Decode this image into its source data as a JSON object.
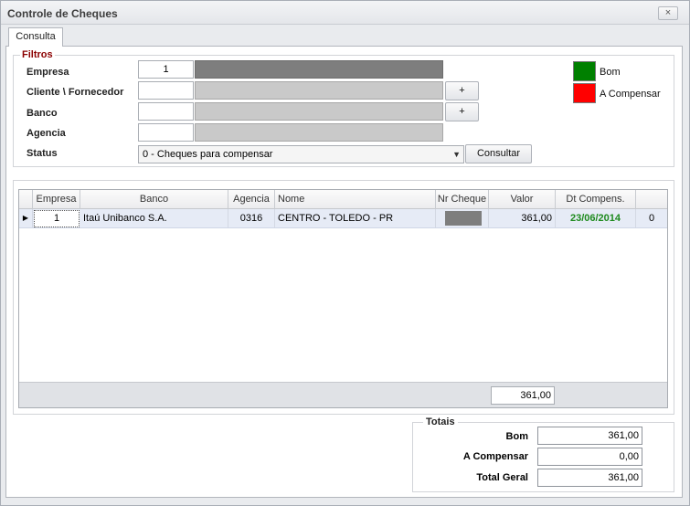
{
  "window": {
    "title": "Controle de Cheques",
    "close_icon": "×"
  },
  "tabs": [
    {
      "label": "Consulta"
    }
  ],
  "filtros": {
    "legend": "Filtros",
    "empresa": {
      "label": "Empresa",
      "value": "1"
    },
    "cliente": {
      "label": "Cliente \\ Fornecedor",
      "value": ""
    },
    "banco": {
      "label": "Banco",
      "value": ""
    },
    "agencia": {
      "label": "Agencia",
      "value": ""
    },
    "status": {
      "label": "Status",
      "value": "0 - Cheques para compensar"
    },
    "add_label": "+",
    "consultar_label": "Consultar"
  },
  "legend": [
    {
      "label": "Bom",
      "color": "#008000"
    },
    {
      "label": "A Compensar",
      "color": "#ff0000"
    }
  ],
  "grid": {
    "columns": [
      "Empresa",
      "Banco",
      "Agencia",
      "Nome",
      "Nr Cheque",
      "Valor",
      "Dt Compens.",
      ""
    ],
    "rows": [
      {
        "empresa": "1",
        "banco": "Itaú Unibanco S.A.",
        "agencia": "0316",
        "nome": "CENTRO - TOLEDO - PR",
        "nr_cheque": "",
        "valor": "361,00",
        "dt_compens": "23/06/2014",
        "extra": "0"
      }
    ],
    "footer_total": "361,00",
    "date_color": "#1e8a1e"
  },
  "totais": {
    "legend": "Totais",
    "bom": {
      "label": "Bom",
      "value": "361,00"
    },
    "a_compensar": {
      "label": "A Compensar",
      "value": "0,00"
    },
    "total_geral": {
      "label": "Total Geral",
      "value": "361,00"
    }
  }
}
